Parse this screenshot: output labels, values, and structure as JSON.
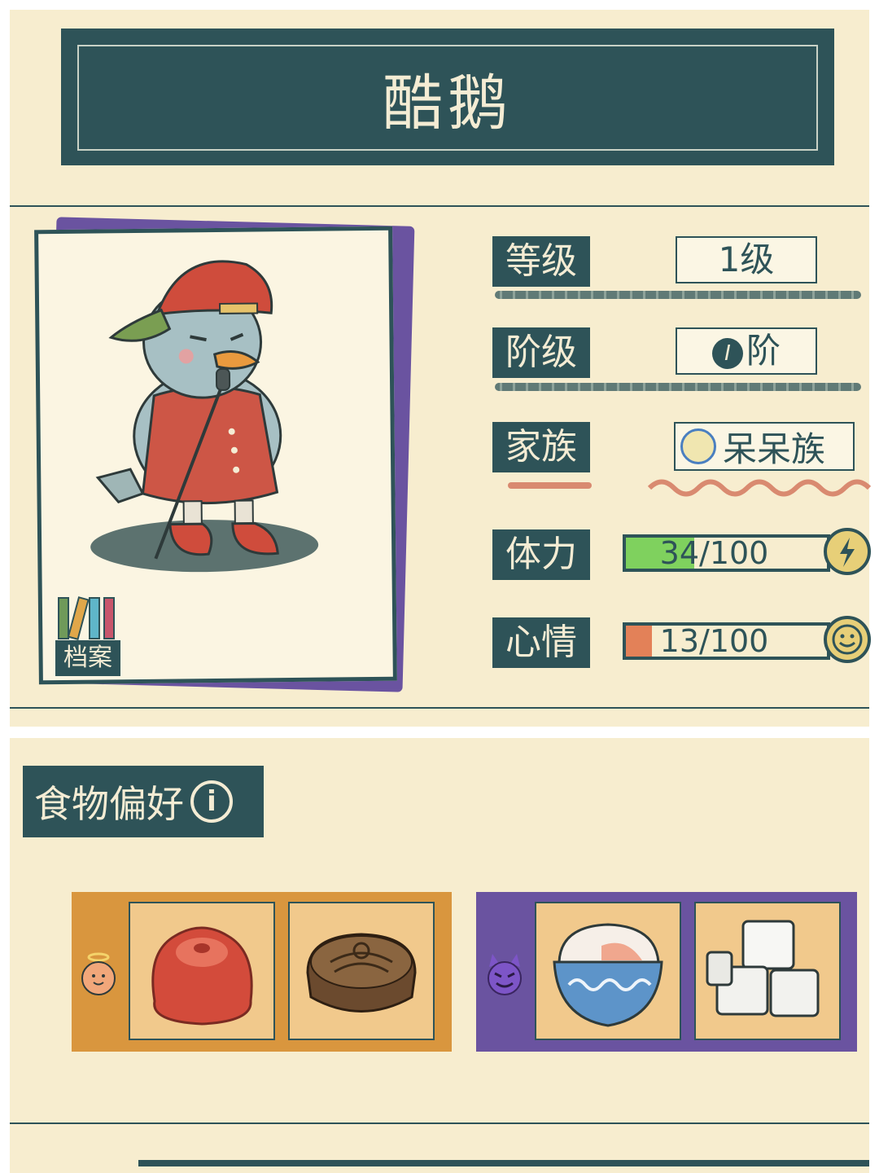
{
  "character": {
    "name": "酷鹅"
  },
  "stats": {
    "level": {
      "label": "等级",
      "value": "1级"
    },
    "rank": {
      "label": "阶级",
      "value": "阶",
      "badge": "I"
    },
    "family": {
      "label": "家族",
      "value": "呆呆族"
    },
    "stamina": {
      "label": "体力",
      "text": "34/100",
      "current": 34,
      "max": 100,
      "fill_color": "#7fd15e",
      "icon": "lightning-icon"
    },
    "mood": {
      "label": "心情",
      "text": "13/100",
      "current": 13,
      "max": 100,
      "fill_color": "#e38158",
      "icon": "smiley-icon"
    }
  },
  "archive": {
    "label": "档案",
    "icon": "books-icon"
  },
  "food_preferences": {
    "title": "食物偏好",
    "info_icon": "i",
    "liked": {
      "icon": "angel-face-icon",
      "panel_color": "#d9963e",
      "items": [
        "red-jelly-icon",
        "mooncake-icon"
      ]
    },
    "disliked": {
      "icon": "devil-face-icon",
      "panel_color": "#6a53a0",
      "items": [
        "shaved-ice-bowl-icon",
        "sugar-cubes-icon"
      ]
    }
  },
  "colors": {
    "background": "#f7edcf",
    "primary": "#2e5358",
    "text_light": "#f4ecd4"
  }
}
